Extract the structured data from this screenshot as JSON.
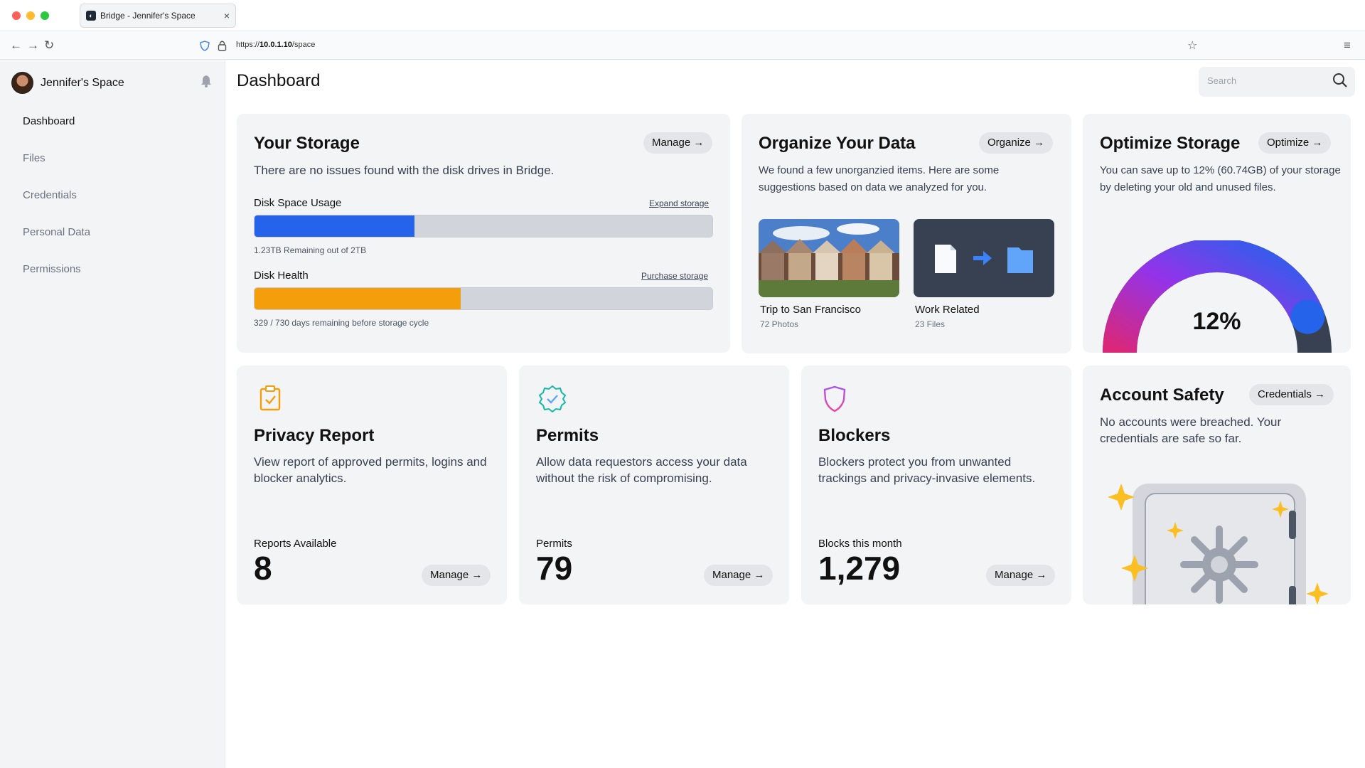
{
  "browser": {
    "tab_title": "Bridge - Jennifer's Space",
    "url_prefix": "https://",
    "url_host": "10.0.1.10",
    "url_path": "/space"
  },
  "sidebar": {
    "space_name": "Jennifer's Space",
    "items": [
      {
        "label": "Dashboard",
        "active": true
      },
      {
        "label": "Files",
        "active": false
      },
      {
        "label": "Credentials",
        "active": false
      },
      {
        "label": "Personal Data",
        "active": false
      },
      {
        "label": "Permissions",
        "active": false
      }
    ]
  },
  "header": {
    "title": "Dashboard",
    "search_placeholder": "Search"
  },
  "storage": {
    "title": "Your Storage",
    "action": "Manage",
    "description": "There are no issues found with the disk drives in Bridge.",
    "disk_space_label": "Disk Space Usage",
    "disk_space_link": "Expand storage",
    "disk_space_note": "1.23TB Remaining out of 2TB",
    "disk_space_fraction": 0.35,
    "disk_space_color": "#2563eb",
    "disk_health_label": "Disk Health",
    "disk_health_link": "Purchase storage",
    "disk_health_note": "329 / 730 days remaining before storage cycle",
    "disk_health_fraction": 0.45,
    "disk_health_color": "#f59e0b"
  },
  "organize": {
    "title": "Organize Your Data",
    "action": "Organize",
    "description": "We found a few unorganzied items. Here are some suggestions based on data we analyzed for you.",
    "items": [
      {
        "title": "Trip to San Francisco",
        "sub": "72 Photos"
      },
      {
        "title": "Work Related",
        "sub": "23 Files"
      }
    ]
  },
  "optimize": {
    "title": "Optimize Storage",
    "action": "Optimize",
    "description": "You can save up to 12% (60.74GB) of your storage by deleting your old and unused files.",
    "percent_label": "12%",
    "gauge_value": 0.88
  },
  "privacy": {
    "title": "Privacy Report",
    "description": "View report of approved permits, logins and blocker analytics.",
    "stat_label": "Reports Available",
    "stat_value": "8",
    "action": "Manage",
    "icon": "clipboard-check-icon",
    "icon_color": "#f59e0b"
  },
  "permits": {
    "title": "Permits",
    "description": "Allow data requestors access your data without the risk of compromising.",
    "stat_label": "Permits",
    "stat_value": "79",
    "action": "Manage",
    "icon": "badge-check-icon",
    "icon_color": "#14b8a6"
  },
  "blockers": {
    "title": "Blockers",
    "description": "Blockers protect you from unwanted trackings and privacy-invasive elements.",
    "stat_label": "Blocks this month",
    "stat_value": "1,279",
    "action": "Manage",
    "icon": "shield-icon",
    "icon_color": "#a855f7"
  },
  "safety": {
    "title": "Account Safety",
    "action": "Credentials",
    "description": "No accounts were breached. Your credentials are safe so far."
  }
}
